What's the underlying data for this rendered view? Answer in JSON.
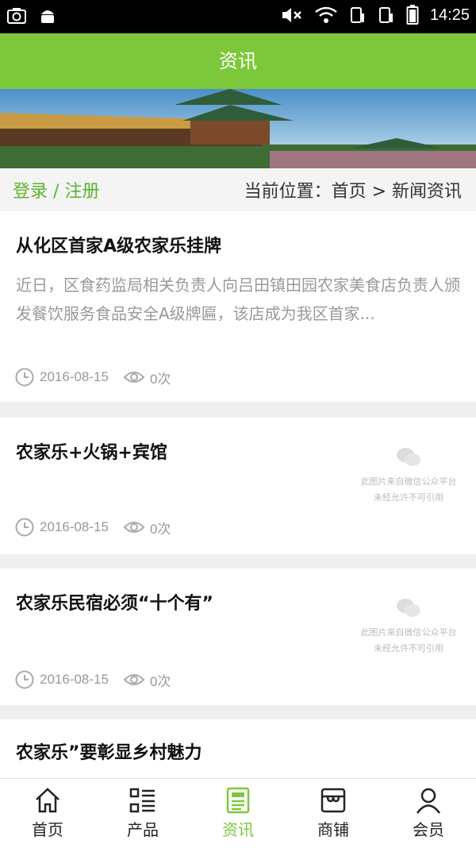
{
  "status": {
    "time": "14:25"
  },
  "header": {
    "title": "资讯"
  },
  "crumb_row": {
    "login": "登录",
    "separator": "/",
    "register": "注册",
    "location": "当前位置：首页 > 新闻资讯"
  },
  "articles": [
    {
      "title": "从化区首家A级农家乐挂牌",
      "summary": "近日，区食药监局相关负责人向吕田镇田园农家美食店负责人颁发餐饮服务食品安全A级牌匾，该店成为我区首家...",
      "date": "2016-08-15",
      "views": "0次"
    },
    {
      "title": "农家乐+火锅+宾馆",
      "date": "2016-08-15",
      "views": "0次",
      "thumb_line1": "此图片来自微信公众平台",
      "thumb_line2": "未经允许不可引用"
    },
    {
      "title": "农家乐民宿必须“十个有”",
      "date": "2016-08-15",
      "views": "0次",
      "thumb_line1": "此图片来自微信公众平台",
      "thumb_line2": "未经允许不可引用"
    },
    {
      "title": "农家乐”要彰显乡村魅力"
    }
  ],
  "tabbar": {
    "items": [
      {
        "label": "首页",
        "icon": "home-icon"
      },
      {
        "label": "产品",
        "icon": "list-grid-icon"
      },
      {
        "label": "资讯",
        "icon": "news-icon",
        "active": true
      },
      {
        "label": "商铺",
        "icon": "shop-icon"
      },
      {
        "label": "会员",
        "icon": "user-icon"
      }
    ]
  },
  "colors": {
    "accent": "#7dc83a",
    "link": "#5eb32f"
  }
}
